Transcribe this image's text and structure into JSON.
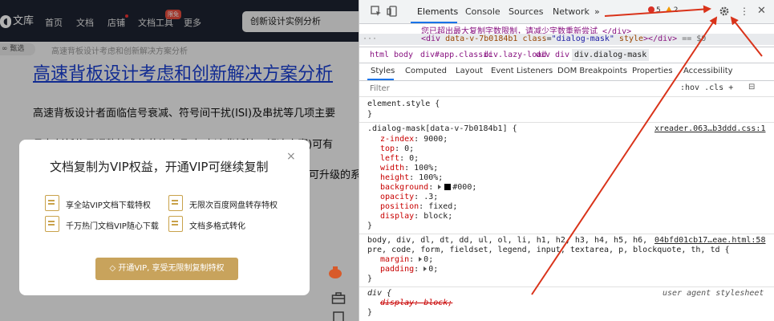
{
  "webpage": {
    "logo_text": "文库",
    "nav": [
      {
        "label": "首页"
      },
      {
        "label": "文档"
      },
      {
        "label": "店铺"
      },
      {
        "label": "文档工具",
        "badge": "限免"
      },
      {
        "label": "更多"
      }
    ],
    "search_value": "创新设计实例分析",
    "breadcrumb_tag": "甄选",
    "breadcrumb": "高速背板设计考虑和创新解决方案分析",
    "title": "高速背板设计考虑和创新解决方案分析",
    "paragraph_line1": "高速背板设计者面临信号衰减、符号间干扰(ISI)及串扰等几项主要",
    "paragraph_line2": "具有创新信号调整技术的芯片产品(如高速背板接口解决方案)可有",
    "paragraph_line3_tail": "可升级的系",
    "dialog": {
      "title": "文档复制为VIP权益，开通VIP可继续复制",
      "features": [
        "享全站VIP文档下载特权",
        "无限次百度网盘转存特权",
        "千万热门文档VIP随心下载",
        "文档多格式转化"
      ],
      "button": "开通VIP, 享受无限制复制特权",
      "close": "×"
    }
  },
  "devtools": {
    "tabs": [
      "Elements",
      "Console",
      "Sources",
      "Network"
    ],
    "more": "»",
    "error_count": "5",
    "warning_count": "2",
    "dom_line1": "您已超出最大复制字数限制，请减少字数重新尝试 </div>",
    "dom_line2": {
      "open_tag": "<div",
      "attr1": "data-v-7b0184b1",
      "attr2_name": "class",
      "attr2_value": "\"dialog-mask\"",
      "attr3": "style",
      "close": "></div>",
      "eq": "== $0"
    },
    "breadcrumbs": [
      "html",
      "body",
      "div#app.classic",
      "div.lazy-load",
      "div",
      "div",
      "div.dialog-mask"
    ],
    "subtabs": [
      "Styles",
      "Computed",
      "Layout",
      "Event Listeners",
      "DOM Breakpoints",
      "Properties",
      "Accessibility"
    ],
    "filter_placeholder": "Filter",
    "filter_tools": ":hov  .cls  +",
    "rules": [
      {
        "selector": "element.style {",
        "props": [],
        "close": "}"
      },
      {
        "selector": ".dialog-mask[data-v-7b0184b1] {",
        "source": "xreader.063…b3ddd.css:1",
        "props": [
          {
            "name": "z-index",
            "value": "9000;"
          },
          {
            "name": "top",
            "value": "0;"
          },
          {
            "name": "left",
            "value": "0;"
          },
          {
            "name": "width",
            "value": "100%;"
          },
          {
            "name": "height",
            "value": "100%;"
          },
          {
            "name": "background",
            "value": "#000;"
          },
          {
            "name": "opacity",
            "value": ".3;"
          },
          {
            "name": "position",
            "value": "fixed;"
          },
          {
            "name": "display",
            "value": "block;"
          }
        ],
        "close": "}"
      },
      {
        "selector": "body, div, dl, dt, dd, ul, ol, li, h1, h2, h3, h4, h5, h6,",
        "selector2": "pre, code, form, fieldset, legend, input, textarea, p, blockquote, th, td {",
        "source": "04bfd01cb17…eae.html:58",
        "props": [
          {
            "name": "margin",
            "value": "0;"
          },
          {
            "name": "padding",
            "value": "0;"
          }
        ],
        "close": "}"
      },
      {
        "selector": "div {",
        "source": "user agent stylesheet",
        "props": [
          {
            "name": "display",
            "value": "block;"
          }
        ],
        "close": "}"
      }
    ]
  },
  "colors": {
    "nav_bg": "#1e2331",
    "link_blue": "#1a3fd1",
    "vip_gold": "#c8a35c",
    "devtools_accent": "#1a73e8",
    "annotation_red": "#d9331a"
  }
}
